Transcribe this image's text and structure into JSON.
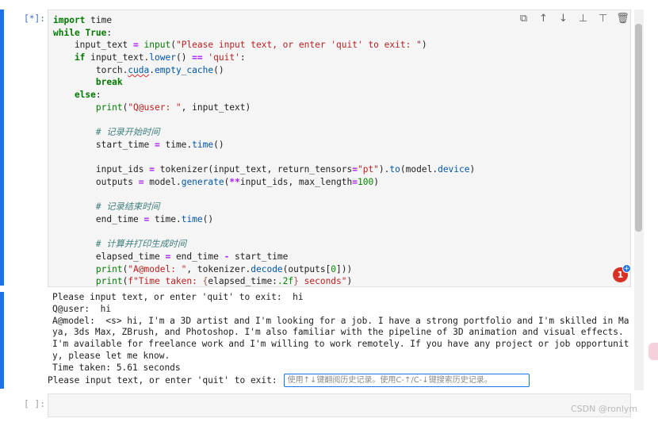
{
  "cells": {
    "running_prompt": "[*]:",
    "empty_prompt": "[ ]:"
  },
  "code": {
    "l1_kw": "import",
    "l1_rest": " time",
    "l2_kw": "while",
    "l2_true": "True",
    "l2_colon": ":",
    "l3_var": "    input_text ",
    "l3_eq": "=",
    "l3_fn": " input",
    "l3_p1": "(",
    "l3_str": "\"Please input text, or enter 'quit' to exit: \"",
    "l3_p2": ")",
    "l4_kw": "    if",
    "l4_a": " input_text",
    "l4_dot": ".",
    "l4_at": "lower",
    "l4_b": "() ",
    "l4_eq": "==",
    "l4_sp": " ",
    "l4_str": "'quit'",
    "l4_colon": ":",
    "l5_a": "        torch",
    "l5_dot": ".",
    "l5_err": "cuda",
    "l5_dot2": ".",
    "l5_at": "empty_cache",
    "l5_b": "()",
    "l6_kw": "        break",
    "l7_kw": "    else",
    "l7_colon": ":",
    "l8_fn": "        print",
    "l8_p1": "(",
    "l8_str": "\"Q@user: \"",
    "l8_rest": ", input_text)",
    "l10_cm": "        # 记录开始时间",
    "l11_a": "        start_time ",
    "l11_eq": "=",
    "l11_b": " time",
    "l11_dot": ".",
    "l11_at": "time",
    "l11_c": "()",
    "l13_a": "        input_ids ",
    "l13_eq": "=",
    "l13_b": " tokenizer(input_text, return_tensors",
    "l13_eq2": "=",
    "l13_str": "\"pt\"",
    "l13_c": ")",
    "l13_dot": ".",
    "l13_at": "to",
    "l13_d": "(model",
    "l13_dot2": ".",
    "l13_at2": "device",
    "l13_e": ")",
    "l14_a": "        outputs ",
    "l14_eq": "=",
    "l14_b": " model",
    "l14_dot": ".",
    "l14_at": "generate",
    "l14_c": "(",
    "l14_op": "**",
    "l14_d": "input_ids, max_length",
    "l14_eq2": "=",
    "l14_num": "100",
    "l14_e": ")",
    "l16_cm": "        # 记录结束时间",
    "l17_a": "        end_time ",
    "l17_eq": "=",
    "l17_b": " time",
    "l17_dot": ".",
    "l17_at": "time",
    "l17_c": "()",
    "l19_cm": "        # 计算并打印生成时间",
    "l20_a": "        elapsed_time ",
    "l20_eq": "=",
    "l20_b": " end_time ",
    "l20_op": "-",
    "l20_c": " start_time",
    "l21_fn": "        print",
    "l21_p1": "(",
    "l21_str": "\"A@model: \"",
    "l21_b": ", tokenizer",
    "l21_dot": ".",
    "l21_at": "decode",
    "l21_c": "(outputs[",
    "l21_num": "0",
    "l21_d": "]))",
    "l22_fn": "        print",
    "l22_p1": "(",
    "l22_str1": "f\"Time taken: ",
    "l22_br1": "{",
    "l22_mid": "elapsed_time:",
    "l22_fmt": ".2f",
    "l22_br2": "}",
    "l22_str2": " seconds\"",
    "l22_p2": ")"
  },
  "toolbar": {
    "copy_icon": "copy-icon",
    "up_icon": "arrow-up-icon",
    "down_icon": "arrow-down-icon",
    "insert_above_icon": "insert-above-icon",
    "insert_below_icon": "insert-below-icon",
    "delete_icon": "trash-icon",
    "copy_glyph": "⧉",
    "up_glyph": "↑",
    "down_glyph": "↓",
    "insert_above_glyph": "⊥",
    "insert_below_glyph": "⊤",
    "delete_glyph": "🗑"
  },
  "notification": {
    "count": "1",
    "plus": "+"
  },
  "output": {
    "lines": [
      "Please input text, or enter 'quit' to exit:  hi",
      "Q@user:  hi",
      "A@model:  <s> hi, I'm a 3D artist and I'm looking for a job. I have a strong portfolio and I'm skilled in Ma",
      "ya, 3ds Max, ZBrush, and Photoshop. I'm also familiar with the pipeline of 3D animation and visual effects.",
      "I'm available for freelance work and I'm willing to work remotely. If you have any project or job opportunit",
      "y, please let me know.",
      "Time taken: 5.61 seconds"
    ],
    "input_label": "Please input text, or enter 'quit' to exit:",
    "input_placeholder": "使用↑↓键翻阅历史记录。使用C-↑/C-↓键搜索历史记录。"
  },
  "watermark": "CSDN @ronlym",
  "colors": {
    "accent": "#1a73e8",
    "keyword": "#007a00",
    "string": "#ba2121",
    "operator": "#aa22ff",
    "comment": "#408080"
  }
}
